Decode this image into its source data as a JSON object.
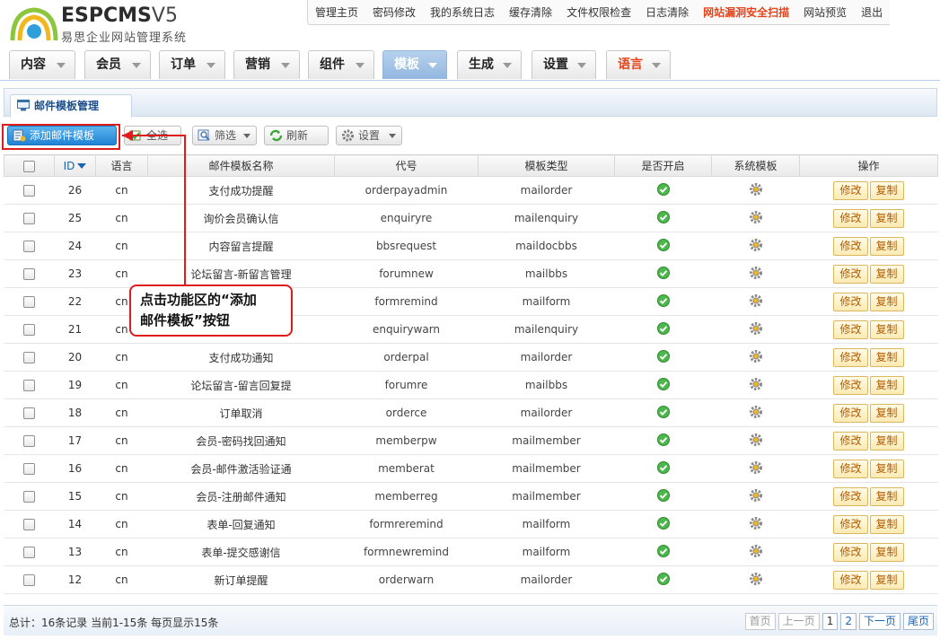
{
  "header": {
    "logo_main": "ESPCMS",
    "logo_version": "V5",
    "logo_sub": "易思企业网站管理系统",
    "top_links": [
      {
        "label": "管理主页",
        "hl": false
      },
      {
        "label": "密码修改",
        "hl": false
      },
      {
        "label": "我的系统日志",
        "hl": false
      },
      {
        "label": "缓存清除",
        "hl": false
      },
      {
        "label": "文件权限检查",
        "hl": false
      },
      {
        "label": "日志清除",
        "hl": false
      },
      {
        "label": "网站漏洞安全扫描",
        "hl": true
      },
      {
        "label": "网站预览",
        "hl": false
      },
      {
        "label": "退出",
        "hl": false
      }
    ]
  },
  "main_tabs": [
    {
      "label": "内容",
      "state": "normal"
    },
    {
      "label": "会员",
      "state": "normal"
    },
    {
      "label": "订单",
      "state": "normal"
    },
    {
      "label": "营销",
      "state": "normal"
    },
    {
      "label": "组件",
      "state": "normal"
    },
    {
      "label": "模板",
      "state": "active"
    },
    {
      "label": "生成",
      "state": "normal"
    },
    {
      "label": "设置",
      "state": "normal"
    },
    {
      "label": "语言",
      "state": "red"
    }
  ],
  "sub_tab": "邮件模板管理",
  "toolbar": {
    "add": "添加邮件模板",
    "select_all": "全选",
    "filter": "筛选",
    "refresh": "刷新",
    "settings": "设置"
  },
  "table": {
    "headers": [
      "",
      "ID",
      "语言",
      "邮件模板名称",
      "代号",
      "模板类型",
      "是否开启",
      "系统模板",
      "操作"
    ],
    "edit_label": "修改",
    "copy_label": "复制",
    "rows": [
      {
        "id": "26",
        "lang": "cn",
        "name": "支付成功提醒",
        "code": "orderpayadmin",
        "type": "mailorder"
      },
      {
        "id": "25",
        "lang": "cn",
        "name": "询价会员确认信",
        "code": "enquiryre",
        "type": "mailenquiry"
      },
      {
        "id": "24",
        "lang": "cn",
        "name": "内容留言提醒",
        "code": "bbsrequest",
        "type": "maildocbbs"
      },
      {
        "id": "23",
        "lang": "cn",
        "name": "论坛留言-新留言管理",
        "code": "forumnew",
        "type": "mailbbs"
      },
      {
        "id": "22",
        "lang": "cn",
        "name": "",
        "code": "formremind",
        "type": "mailform"
      },
      {
        "id": "21",
        "lang": "cn",
        "name": "",
        "code": "enquirywarn",
        "type": "mailenquiry"
      },
      {
        "id": "20",
        "lang": "cn",
        "name": "支付成功通知",
        "code": "orderpal",
        "type": "mailorder"
      },
      {
        "id": "19",
        "lang": "cn",
        "name": "论坛留言-留言回复提",
        "code": "forumre",
        "type": "mailbbs"
      },
      {
        "id": "18",
        "lang": "cn",
        "name": "订单取消",
        "code": "orderce",
        "type": "mailorder"
      },
      {
        "id": "17",
        "lang": "cn",
        "name": "会员-密码找回通知",
        "code": "memberpw",
        "type": "mailmember"
      },
      {
        "id": "16",
        "lang": "cn",
        "name": "会员-邮件激活验证通",
        "code": "memberat",
        "type": "mailmember"
      },
      {
        "id": "15",
        "lang": "cn",
        "name": "会员-注册邮件通知",
        "code": "memberreg",
        "type": "mailmember"
      },
      {
        "id": "14",
        "lang": "cn",
        "name": "表单-回复通知",
        "code": "formreremind",
        "type": "mailform"
      },
      {
        "id": "13",
        "lang": "cn",
        "name": "表单-提交感谢信",
        "code": "formnewremind",
        "type": "mailform"
      },
      {
        "id": "12",
        "lang": "cn",
        "name": "新订单提醒",
        "code": "orderwarn",
        "type": "mailorder"
      }
    ]
  },
  "footer": {
    "summary": "总计：16条记录 当前1-15条 每页显示15条",
    "pager": [
      {
        "label": "首页",
        "state": "dis"
      },
      {
        "label": "上一页",
        "state": "dis"
      },
      {
        "label": "1",
        "state": "cur"
      },
      {
        "label": "2",
        "state": "link"
      },
      {
        "label": "下一页",
        "state": "link"
      },
      {
        "label": "尾页",
        "state": "link"
      }
    ]
  },
  "callout": "点击功能区的“添加\n邮件模板”按钮",
  "colors": {
    "accent": "#1f83d5",
    "highlight": "#e01b1b",
    "tab_active": "#93b7e0"
  }
}
